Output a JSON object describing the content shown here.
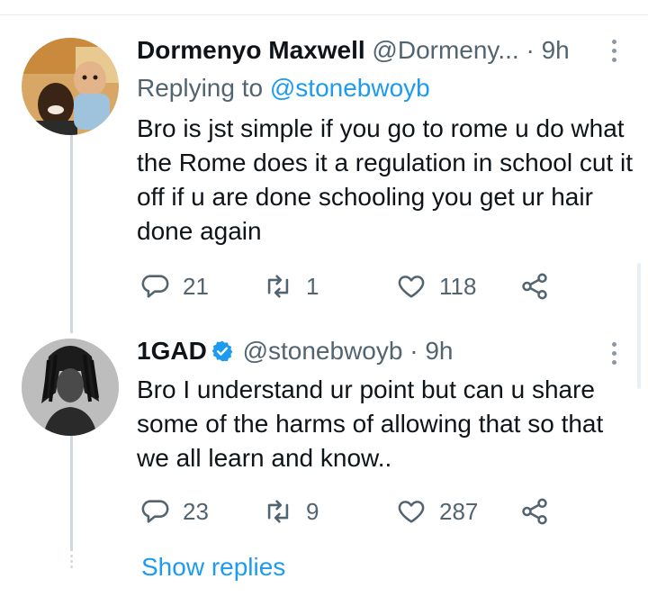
{
  "tweets": [
    {
      "display_name": "Dormenyo Maxwell",
      "handle": "@Dormeny...",
      "time": "· 9h",
      "replying_prefix": "Replying to",
      "replying_to": "@stonebwoyb",
      "text": "Bro is jst simple if you go to rome u do what the Rome does it a regulation in school cut it off if u are done schooling you get ur hair done again",
      "replies": "21",
      "retweets": "1",
      "likes": "118",
      "avatar_icon": "profile-photo-man-with-child"
    },
    {
      "display_name": "1GAD",
      "handle": "@stonebwoyb",
      "time": "· 9h",
      "verified": true,
      "text": "Bro I understand ur point but can u share some of the harms of allowing that so that we all learn and know..",
      "replies": "23",
      "retweets": "9",
      "likes": "287",
      "avatar_icon": "profile-photo-dreadlocks-bw"
    }
  ],
  "show_replies_label": "Show replies",
  "colors": {
    "accent": "#1d9bf0",
    "muted": "#536471",
    "text": "#0f1419",
    "thread_line": "#cfd9de"
  }
}
